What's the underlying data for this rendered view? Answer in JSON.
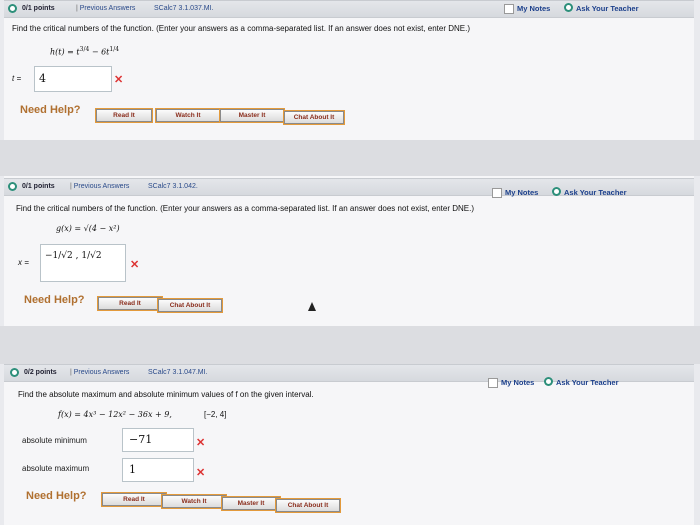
{
  "problems": [
    {
      "points": "0/1 points",
      "meta": "Previous Answers",
      "code": "SCalc7 3.1.037.MI.",
      "my_notes": "My Notes",
      "ask_teacher": "Ask Your Teacher",
      "prompt": "Find the critical numbers of the function. (Enter your answers as a comma-separated list. If an answer does not exist, enter DNE.)",
      "function_lhs": "h(t) = t",
      "function_exp1": "3/4",
      "function_mid": " − 6t",
      "function_exp2": "1/4",
      "answer_label": "t =",
      "answer_value": "4",
      "result_mark": "✕",
      "need_help": "Need Help?",
      "buttons": [
        "Read It",
        "Watch It",
        "Master It",
        "Chat About It"
      ]
    },
    {
      "points": "0/1 points",
      "meta": "Previous Answers",
      "code": "SCalc7 3.1.042.",
      "my_notes": "My Notes",
      "ask_teacher": "Ask Your Teacher",
      "prompt": "Find the critical numbers of the function. (Enter your answers as a comma-separated list. If an answer does not exist, enter DNE.)",
      "function_text": "g(x) = √(4 − x²)",
      "answer_label": "x =",
      "answer_value": "−1/√2 , 1/√2",
      "result_mark": "✕",
      "need_help": "Need Help?",
      "buttons": [
        "Read It",
        "Chat About It"
      ]
    },
    {
      "points": "0/2 points",
      "meta": "Previous Answers",
      "code": "SCalc7 3.1.047.MI.",
      "my_notes": "My Notes",
      "ask_teacher": "Ask Your Teacher",
      "prompt": "Find the absolute maximum and absolute minimum values of f on the given interval.",
      "function_text": "f(x) = 4x³ − 12x² − 36x + 9,",
      "interval": "[−2, 4]",
      "min_label": "absolute minimum",
      "min_value": "−71",
      "max_label": "absolute maximum",
      "max_value": "1",
      "result_mark": "✕",
      "need_help": "Need Help?",
      "buttons": [
        "Read It",
        "Watch It",
        "Master It",
        "Chat About It"
      ]
    }
  ]
}
